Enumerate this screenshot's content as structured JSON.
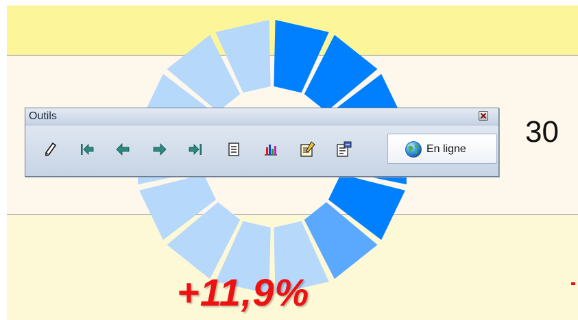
{
  "gauge": {
    "segments_total": 14,
    "colors": {
      "dark": "#0080ff",
      "medium": "#5aa9ff",
      "light": "#b6d8fb"
    },
    "segment_shades": [
      "dark",
      "dark",
      "dark",
      "dark",
      "dark",
      "medium",
      "light",
      "light",
      "light",
      "light",
      "light",
      "light",
      "light",
      "light"
    ]
  },
  "indicator": {
    "percent_text": "+11,9%",
    "percent_color": "#ee1111",
    "side_value": "30"
  },
  "toolbar": {
    "title": "Outils",
    "buttons": [
      {
        "name": "edit-pencil-icon",
        "icon": "pencil"
      },
      {
        "name": "first-record-icon",
        "icon": "arrow-first"
      },
      {
        "name": "previous-record-icon",
        "icon": "arrow-left"
      },
      {
        "name": "next-record-icon",
        "icon": "arrow-right"
      },
      {
        "name": "last-record-icon",
        "icon": "arrow-last"
      },
      {
        "name": "list-view-icon",
        "icon": "document"
      },
      {
        "name": "chart-view-icon",
        "icon": "bar-chart"
      },
      {
        "name": "edit-form-icon",
        "icon": "form-edit"
      },
      {
        "name": "properties-icon",
        "icon": "properties"
      }
    ],
    "online_label": "En ligne",
    "online_icon": "globe-icon"
  }
}
